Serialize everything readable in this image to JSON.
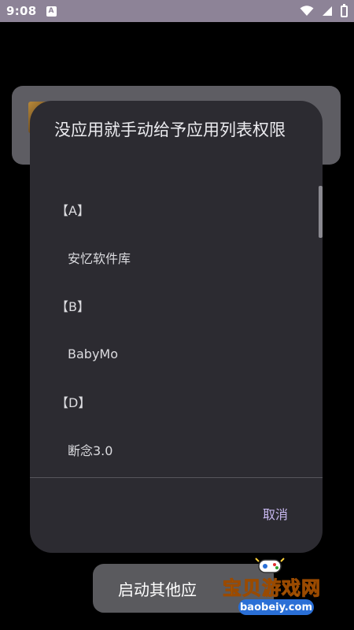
{
  "status_bar": {
    "time": "9:08",
    "app_icon_letter": "A"
  },
  "background": {
    "bottom_button_label": "启动其他应"
  },
  "dialog": {
    "title": "没应用就手动给予应用列表权限",
    "rows": [
      {
        "type": "header",
        "text": "【A】"
      },
      {
        "type": "item",
        "text": "安忆软件库"
      },
      {
        "type": "header",
        "text": "【B】"
      },
      {
        "type": "item",
        "text": "BabyMo"
      },
      {
        "type": "header",
        "text": "【D】"
      },
      {
        "type": "item",
        "text": "断念3.0"
      }
    ],
    "cancel_label": "取消"
  },
  "watermark": {
    "text": "宝贝游戏网",
    "url": "baobeiy.com"
  },
  "colors": {
    "status_bar": "#8d8397",
    "dialog_bg": "#2c2b31",
    "accent": "#c8b8f0"
  }
}
